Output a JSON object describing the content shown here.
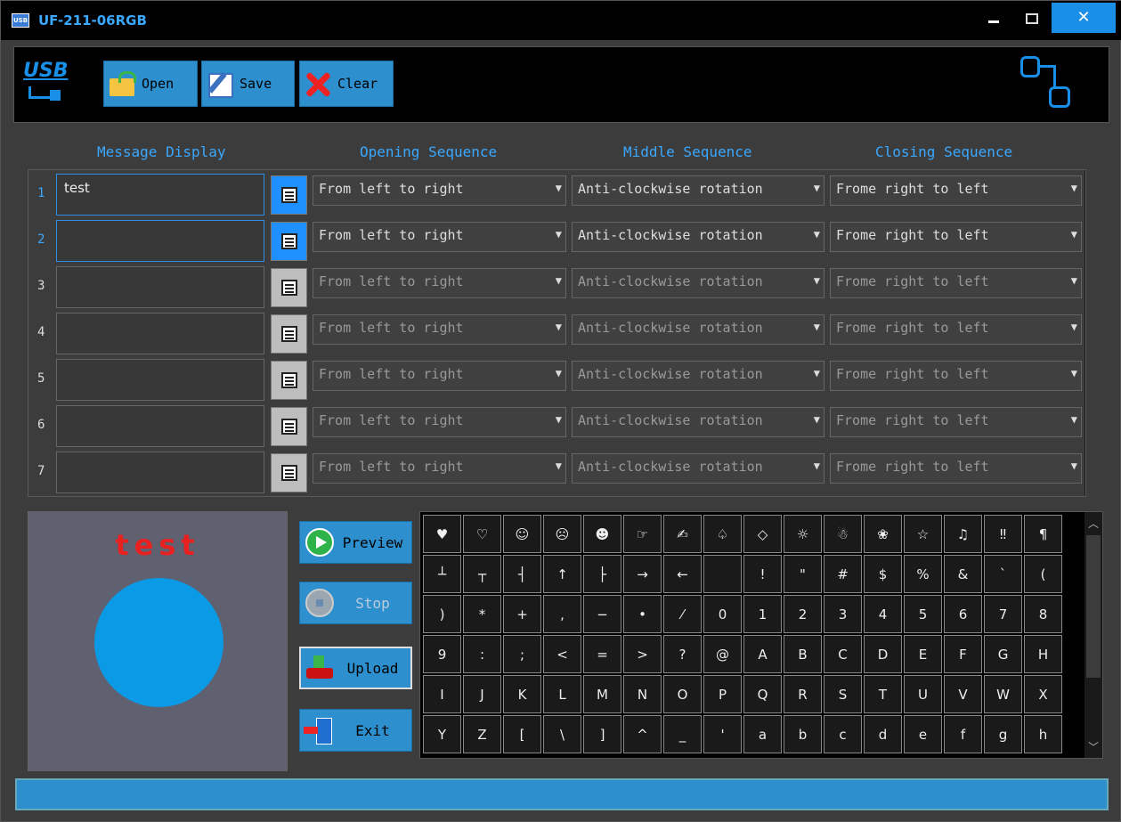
{
  "window": {
    "title": "UF-211-06RGB",
    "app_icon_text": "USB",
    "close_glyph": "✕"
  },
  "toolbar": {
    "logo": "USB",
    "open_label": "Open",
    "save_label": "Save",
    "clear_label": "Clear"
  },
  "headers": {
    "message": "Message Display",
    "opening": "Opening Sequence",
    "middle": "Middle Sequence",
    "closing": "Closing Sequence"
  },
  "rows": [
    {
      "num": "1",
      "message": "test",
      "opening": "From left to right",
      "middle": "Anti-clockwise rotation",
      "closing": "Frome right to left",
      "active": true
    },
    {
      "num": "2",
      "message": "",
      "opening": "From left to right",
      "middle": "Anti-clockwise rotation",
      "closing": "Frome right to left",
      "active": true
    },
    {
      "num": "3",
      "message": "",
      "opening": "From left to right",
      "middle": "Anti-clockwise rotation",
      "closing": "Frome right to left",
      "active": false
    },
    {
      "num": "4",
      "message": "",
      "opening": "From left to right",
      "middle": "Anti-clockwise rotation",
      "closing": "Frome right to left",
      "active": false
    },
    {
      "num": "5",
      "message": "",
      "opening": "From left to right",
      "middle": "Anti-clockwise rotation",
      "closing": "Frome right to left",
      "active": false
    },
    {
      "num": "6",
      "message": "",
      "opening": "From left to right",
      "middle": "Anti-clockwise rotation",
      "closing": "Frome right to left",
      "active": false
    },
    {
      "num": "7",
      "message": "",
      "opening": "From left to right",
      "middle": "Anti-clockwise rotation",
      "closing": "Frome right to left",
      "active": false
    }
  ],
  "preview": {
    "text": "test",
    "circle_color": "#0b9ae6",
    "text_color": "#e82020"
  },
  "actions": {
    "preview": "Preview",
    "stop": "Stop",
    "upload": "Upload",
    "exit": "Exit"
  },
  "symbols": [
    "♥",
    "♡",
    "☺",
    "☹",
    "☻",
    "☞",
    "✍",
    "♤",
    "◇",
    "☼",
    "☃",
    "❀",
    "☆",
    "♫",
    "‼",
    "¶",
    "┴",
    "┬",
    "┤",
    "↑",
    "├",
    "→",
    "←",
    " ",
    "!",
    "\"",
    "#",
    "$",
    "%",
    "&",
    "`",
    "(",
    ")",
    "*",
    "+",
    ",",
    "−",
    "•",
    "⁄",
    "0",
    "1",
    "2",
    "3",
    "4",
    "5",
    "6",
    "7",
    "8",
    "9",
    ":",
    ";",
    "<",
    "=",
    ">",
    "?",
    "@",
    "A",
    "B",
    "C",
    "D",
    "E",
    "F",
    "G",
    "H",
    "I",
    "J",
    "K",
    "L",
    "M",
    "N",
    "O",
    "P",
    "Q",
    "R",
    "S",
    "T",
    "U",
    "V",
    "W",
    "X",
    "Y",
    "Z",
    "[",
    "\\",
    "]",
    "^",
    "_",
    "'",
    "a",
    "b",
    "c",
    "d",
    "e",
    "f",
    "g",
    "h"
  ],
  "accent_color": "#2e8fce"
}
